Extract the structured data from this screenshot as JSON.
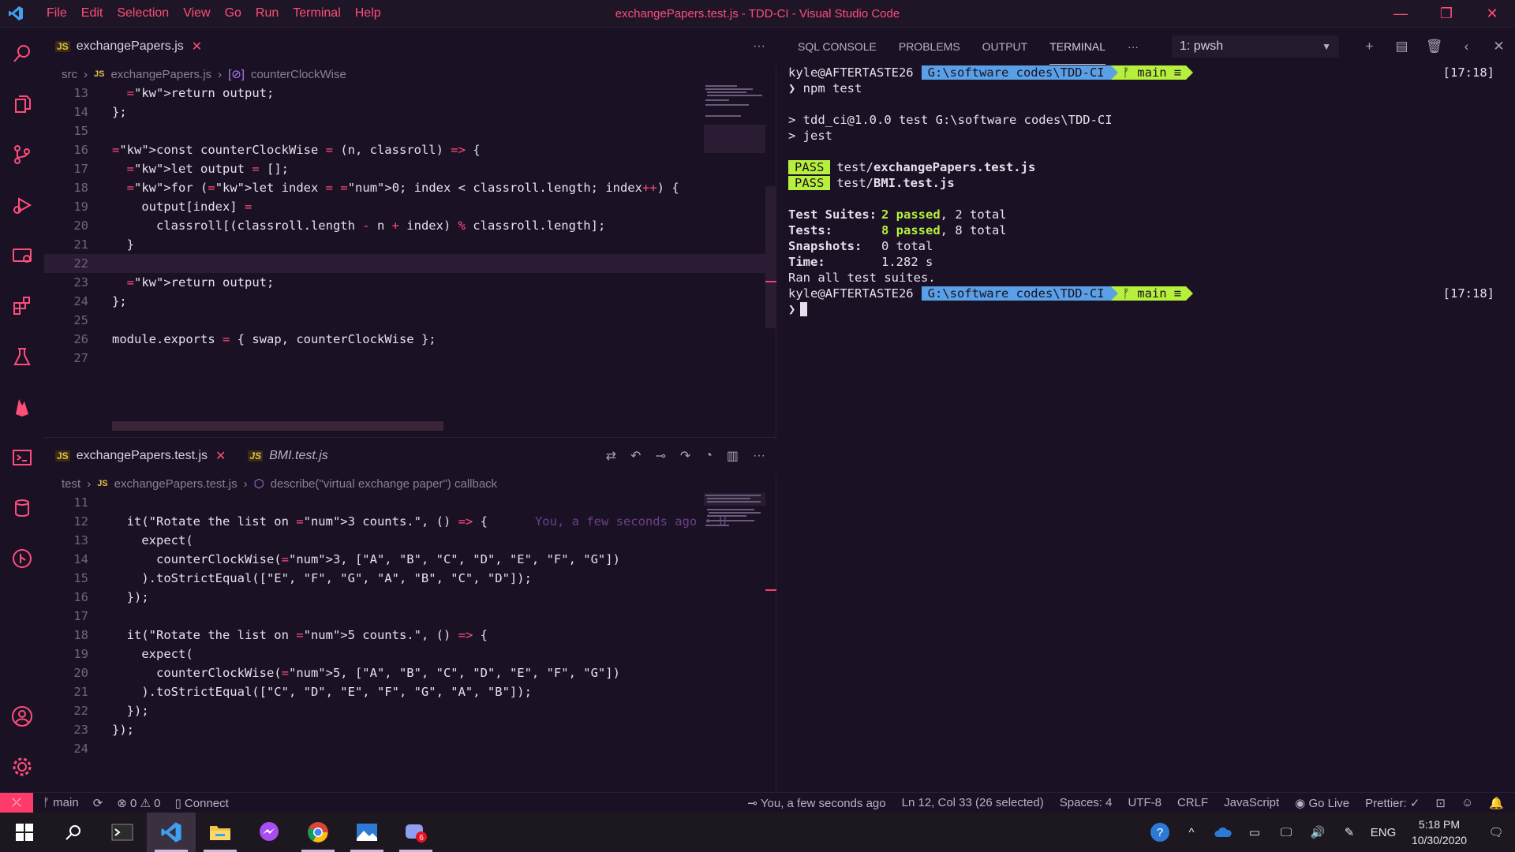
{
  "window": {
    "title": "exchangePapers.test.js - TDD-CI - Visual Studio Code",
    "menu": [
      "File",
      "Edit",
      "Selection",
      "View",
      "Go",
      "Run",
      "Terminal",
      "Help"
    ]
  },
  "editor_top": {
    "tab_label": "exchangePapers.js",
    "breadcrumb": [
      "src",
      "exchangePapers.js",
      "counterClockWise"
    ],
    "lines": [
      {
        "n": "13",
        "code": "  return output;"
      },
      {
        "n": "14",
        "code": "};"
      },
      {
        "n": "15",
        "code": ""
      },
      {
        "n": "16",
        "code": "const counterClockWise = (n, classroll) => {"
      },
      {
        "n": "17",
        "code": "  let output = [];"
      },
      {
        "n": "18",
        "code": "  for (let index = 0; index < classroll.length; index++) {"
      },
      {
        "n": "19",
        "code": "    output[index] ="
      },
      {
        "n": "20",
        "code": "      classroll[(classroll.length - n + index) % classroll.length];"
      },
      {
        "n": "21",
        "code": "  }"
      },
      {
        "n": "22",
        "code": ""
      },
      {
        "n": "23",
        "code": "  return output;"
      },
      {
        "n": "24",
        "code": "};"
      },
      {
        "n": "25",
        "code": ""
      },
      {
        "n": "26",
        "code": "module.exports = { swap, counterClockWise };"
      },
      {
        "n": "27",
        "code": ""
      }
    ]
  },
  "editor_bottom": {
    "tabs": [
      "exchangePapers.test.js",
      "BMI.test.js"
    ],
    "breadcrumb": [
      "test",
      "exchangePapers.test.js",
      "describe(\"virtual exchange paper\") callback"
    ],
    "blame": "You, a few seconds ago • U",
    "lines": [
      {
        "n": "11",
        "code": ""
      },
      {
        "n": "12",
        "code": "  it(\"Rotate the list on 3 counts.\", () => {"
      },
      {
        "n": "13",
        "code": "    expect("
      },
      {
        "n": "14",
        "code": "      counterClockWise(3, [\"A\", \"B\", \"C\", \"D\", \"E\", \"F\", \"G\"])"
      },
      {
        "n": "15",
        "code": "    ).toStrictEqual([\"E\", \"F\", \"G\", \"A\", \"B\", \"C\", \"D\"]);"
      },
      {
        "n": "16",
        "code": "  });"
      },
      {
        "n": "17",
        "code": ""
      },
      {
        "n": "18",
        "code": "  it(\"Rotate the list on 5 counts.\", () => {"
      },
      {
        "n": "19",
        "code": "    expect("
      },
      {
        "n": "20",
        "code": "      counterClockWise(5, [\"A\", \"B\", \"C\", \"D\", \"E\", \"F\", \"G\"])"
      },
      {
        "n": "21",
        "code": "    ).toStrictEqual([\"C\", \"D\", \"E\", \"F\", \"G\", \"A\", \"B\"]);"
      },
      {
        "n": "22",
        "code": "  });"
      },
      {
        "n": "23",
        "code": "});"
      },
      {
        "n": "24",
        "code": ""
      }
    ]
  },
  "panel": {
    "tabs": [
      "SQL CONSOLE",
      "PROBLEMS",
      "OUTPUT",
      "TERMINAL"
    ],
    "active_tab": "TERMINAL",
    "more": "···",
    "terminal_select": "1: pwsh"
  },
  "terminal": {
    "prompt_user": "kyle@AFTERTASTE26",
    "prompt_path": "G:\\software codes\\TDD-CI",
    "prompt_branch": "ᚠ main ≡",
    "time": "[17:18]",
    "command": "❯ npm test",
    "script_line": "> tdd_ci@1.0.0 test G:\\software codes\\TDD-CI",
    "script_cmd": "> jest",
    "pass_label": "PASS",
    "results": [
      {
        "dir": "test/",
        "file": "exchangePapers.test.js"
      },
      {
        "dir": "test/",
        "file": "BMI.test.js"
      }
    ],
    "summary": {
      "suites_label": "Test Suites:",
      "suites_passed": "2 passed",
      "suites_total": ", 2 total",
      "tests_label": "Tests:",
      "tests_passed": "8 passed",
      "tests_total": ", 8 total",
      "snap_label": "Snapshots:",
      "snap_val": "0 total",
      "time_label": "Time:",
      "time_val": "1.282 s",
      "ran": "Ran all test suites."
    },
    "prompt2": "❯"
  },
  "status": {
    "branch": "main",
    "errors": "0",
    "warnings": "0",
    "connect": "Connect",
    "blame": "You, a few seconds ago",
    "position": "Ln 12, Col 33 (26 selected)",
    "spaces": "Spaces: 4",
    "encoding": "UTF-8",
    "eol": "CRLF",
    "language": "JavaScript",
    "golive": "Go Live",
    "prettier": "Prettier: ✓"
  },
  "taskbar": {
    "lang": "ENG",
    "time": "5:18 PM",
    "date": "10/30/2020",
    "notif_badge": "6"
  },
  "colors": {
    "accent": "#ff4d7a",
    "bg": "#1a1224",
    "prompt_path": "#5aa0e6",
    "prompt_git": "#b6f03c"
  }
}
